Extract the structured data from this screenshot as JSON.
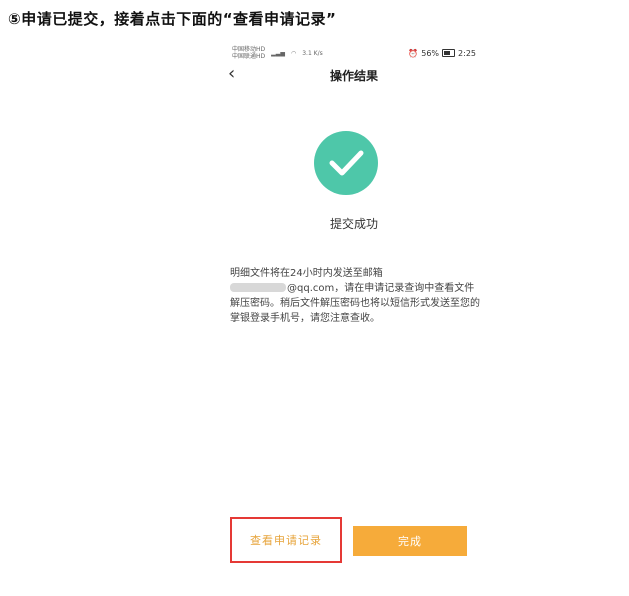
{
  "caption": "⑤申请已提交，接着点击下面的“查看申请记录”",
  "status_bar": {
    "carrier_1": "中国移动HD",
    "carrier_2": "中国联通HD",
    "speed": "3.1 K/s",
    "battery": "56%",
    "time": "2:25"
  },
  "nav": {
    "back_icon": "chevron-left-icon",
    "title": "操作结果"
  },
  "result": {
    "icon": "check-circle-icon",
    "icon_color": "#4ec7a9",
    "message": "提交成功"
  },
  "info": {
    "line1": "明细文件将在24小时内发送至邮箱",
    "email_suffix": "@qq.com，请在申请记录查询中查看文件解压密码。稍后文件解压密码也将以短信形式发送至您的掌银登录手机号，请您注意查收。"
  },
  "buttons": {
    "view_records": "查看申请记录",
    "done": "完成"
  },
  "colors": {
    "accent": "#f6ab3a",
    "highlight_border": "#e53935"
  }
}
